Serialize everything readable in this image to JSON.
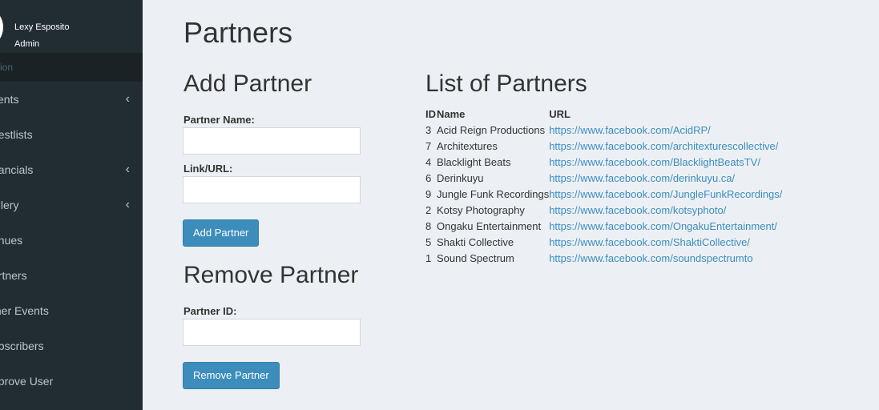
{
  "user": {
    "name": "Lexy Esposito",
    "role": "Admin"
  },
  "sidebar": {
    "header": "ation",
    "items": [
      {
        "label": "vents",
        "chevron": true
      },
      {
        "label": "uestlists",
        "chevron": false
      },
      {
        "label": "nancials",
        "chevron": true
      },
      {
        "label": "allery",
        "chevron": true
      },
      {
        "label": "enues",
        "chevron": false
      },
      {
        "label": "artners",
        "chevron": false
      },
      {
        "label": "ther Events",
        "chevron": false
      },
      {
        "label": "ubscribers",
        "chevron": false
      },
      {
        "label": "pprove User",
        "chevron": false
      }
    ]
  },
  "page": {
    "title": "Partners"
  },
  "add_partner": {
    "heading": "Add Partner",
    "name_label": "Partner Name:",
    "name_value": "",
    "url_label": "Link/URL:",
    "url_value": "",
    "button": "Add Partner"
  },
  "remove_partner": {
    "heading": "Remove Partner",
    "id_label": "Partner ID:",
    "id_value": "",
    "button": "Remove Partner"
  },
  "list": {
    "heading": "List of Partners",
    "columns": [
      "ID",
      "Name",
      "URL"
    ],
    "rows": [
      {
        "id": "3",
        "name": "Acid Reign Productions",
        "url": "https://www.facebook.com/AcidRP/"
      },
      {
        "id": "7",
        "name": "Architextures",
        "url": "https://www.facebook.com/architexturescollective/"
      },
      {
        "id": "4",
        "name": "Blacklight Beats",
        "url": "https://www.facebook.com/BlacklightBeatsTV/"
      },
      {
        "id": "6",
        "name": "Derinkuyu",
        "url": "https://www.facebook.com/derinkuyu.ca/"
      },
      {
        "id": "9",
        "name": "Jungle Funk Recordings",
        "url": "https://www.facebook.com/JungleFunkRecordings/"
      },
      {
        "id": "2",
        "name": "Kotsy Photography",
        "url": "https://www.facebook.com/kotsyphoto/"
      },
      {
        "id": "8",
        "name": "Ongaku Entertainment",
        "url": "https://www.facebook.com/OngakuEntertainment/"
      },
      {
        "id": "5",
        "name": "Shakti Collective",
        "url": "https://www.facebook.com/ShaktiCollective/"
      },
      {
        "id": "1",
        "name": "Sound Spectrum",
        "url": "https://www.facebook.com/soundspectrumto"
      }
    ]
  },
  "colors": {
    "sidebar_bg": "#222d32",
    "sidebar_header_bg": "#1a2226",
    "content_bg": "#ecf0f5",
    "primary": "#3c8dbc"
  },
  "icons": {
    "chevron": "chevron-left-icon",
    "avatar": "avatar"
  }
}
